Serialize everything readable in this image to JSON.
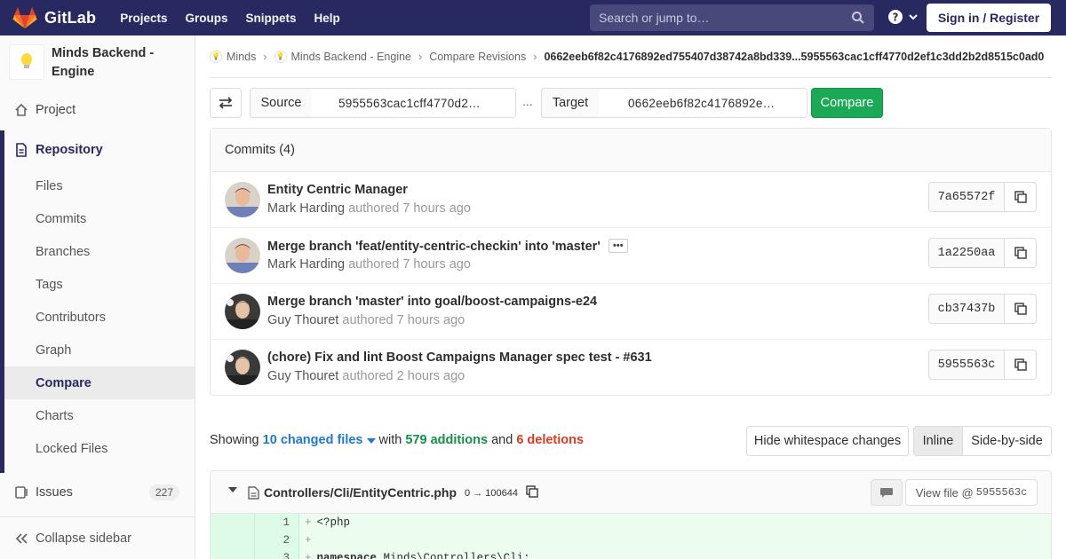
{
  "navbar": {
    "brand": "GitLab",
    "links": [
      "Projects",
      "Groups",
      "Snippets",
      "Help"
    ],
    "search_placeholder": "Search or jump to…",
    "signin": "Sign in / Register"
  },
  "sidebar": {
    "project_name": "Minds Backend - Engine",
    "project": "Project",
    "repository": "Repository",
    "repo_items": [
      "Files",
      "Commits",
      "Branches",
      "Tags",
      "Contributors",
      "Graph",
      "Compare",
      "Charts",
      "Locked Files"
    ],
    "active_item": "Compare",
    "issues": "Issues",
    "issues_count": "227",
    "collapse": "Collapse sidebar"
  },
  "breadcrumb": {
    "items": [
      "Minds",
      "Minds Backend - Engine",
      "Compare Revisions"
    ],
    "current": "0662eeb6f82c4176892ed755407d38742a8bd339...5955563cac1cff4770d2ef1c3dd2b2d8515c0ad0"
  },
  "compare": {
    "source_label": "Source",
    "source_value": "5955563cac1cff4770d2…",
    "dots": "...",
    "target_label": "Target",
    "target_value": "0662eeb6f82c4176892e…",
    "button": "Compare"
  },
  "commits": {
    "header": "Commits (4)",
    "authored": "authored",
    "list": [
      {
        "title": "Entity Centric Manager",
        "author": "Mark Harding",
        "time": "7 hours ago",
        "sha": "7a65572f",
        "ellipsis": false,
        "avatar": "mark"
      },
      {
        "title": "Merge branch 'feat/entity-centric-checkin' into 'master'",
        "author": "Mark Harding",
        "time": "7 hours ago",
        "sha": "1a2250aa",
        "ellipsis": true,
        "avatar": "mark"
      },
      {
        "title": "Merge branch 'master' into goal/boost-campaigns-e24",
        "author": "Guy Thouret",
        "time": "7 hours ago",
        "sha": "cb37437b",
        "ellipsis": false,
        "avatar": "guy"
      },
      {
        "title": "(chore) Fix and lint Boost Campaigns Manager spec test - #631",
        "author": "Guy Thouret",
        "time": "2 hours ago",
        "sha": "5955563c",
        "ellipsis": false,
        "avatar": "guy"
      }
    ]
  },
  "stats": {
    "showing": "Showing",
    "changed": "10 changed files",
    "with": "with",
    "additions": "579 additions",
    "and": "and",
    "deletions": "6 deletions",
    "hide_ws": "Hide whitespace changes",
    "inline": "Inline",
    "side_by_side": "Side-by-side"
  },
  "diff_file": {
    "path": "Controllers/Cli/EntityCentric.php",
    "mode_from": "0",
    "mode_arrow": "→",
    "mode_to": "100644",
    "view_file": "View file @",
    "view_sha": "5955563c",
    "lines": [
      {
        "num": "1",
        "code": "<?php"
      },
      {
        "num": "2",
        "code": ""
      },
      {
        "num": "3",
        "code": "namespace Minds\\Controllers\\Cli;"
      }
    ]
  },
  "colors": {
    "navbar": "#292961",
    "accent": "#1aaa55",
    "link": "#1f78d1",
    "deletion": "#db3b21"
  }
}
